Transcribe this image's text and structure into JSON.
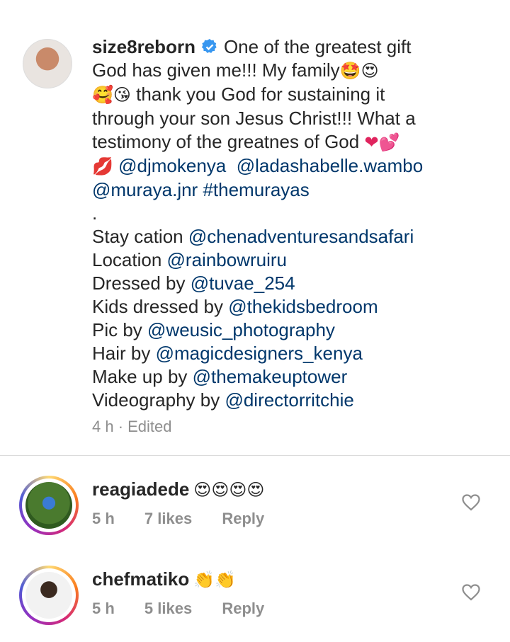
{
  "post": {
    "username": "size8reborn",
    "line1_text": "One of the greatest gift",
    "line2_text": "God has given me!!! My family",
    "line2_emojis": "🤩😍",
    "line3_emojis": "🥰😘",
    "line3_text": " thank you God for sustaining it",
    "line4_text": "through your son Jesus Christ!!! What a",
    "line5_text": "testimony of the greatnes of God ",
    "line5_emojis": "❤💕",
    "line6_emoji": "💋",
    "mention1": "@djmokenya",
    "mention2": "@ladashabelle.wambo",
    "mention3": "@muraya.jnr",
    "hashtag": "#themurayas",
    "dot": ".",
    "credits": [
      {
        "label": "Stay cation ",
        "handle": "@chenadventuresandsafari"
      },
      {
        "label": "Location ",
        "handle": "@rainbowruiru"
      },
      {
        "label": "Dressed by ",
        "handle": "@tuvae_254"
      },
      {
        "label": "Kids dressed by ",
        "handle": "@thekidsbedroom"
      },
      {
        "label": "Pic by ",
        "handle": "@weusic_photography"
      },
      {
        "label": "Hair by ",
        "handle": "@magicdesigners_kenya"
      },
      {
        "label": "Make up by ",
        "handle": "@themakeuptower"
      },
      {
        "label": "Videography by ",
        "handle": "@directorritchie"
      }
    ],
    "meta": "4 h · Edited",
    "verified_icon": "verified-badge-icon"
  },
  "comments": [
    {
      "username": "reagiadede",
      "emojis": "😍😍😍😍",
      "time": "5 h",
      "likes": "7 likes",
      "reply": "Reply"
    },
    {
      "username": "chefmatiko",
      "emojis": "👏👏",
      "time": "5 h",
      "likes": "5 likes",
      "reply": "Reply"
    }
  ],
  "colors": {
    "link": "#00376b",
    "meta": "#8e8e8e",
    "verified": "#3897f0"
  }
}
